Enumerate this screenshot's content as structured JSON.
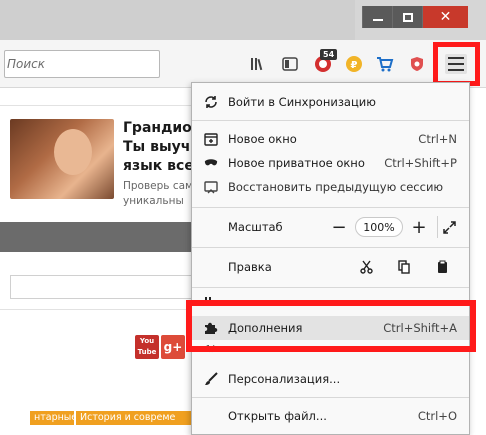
{
  "window": {
    "controls": {
      "minimize": "minimize",
      "maximize": "maximize",
      "close": "✕"
    }
  },
  "toolbar": {
    "search_placeholder": "Поиск",
    "badge_count": "54"
  },
  "page": {
    "headline_lines": [
      "Грандиоз",
      "Ты выучи",
      "язык все"
    ],
    "sub_lines": [
      "Проверь сам",
      "уникальны"
    ],
    "youtube_label_1": "You",
    "youtube_label_2": "Tube",
    "gplus_label": "g+",
    "bottom_tab_1": "нтарные",
    "bottom_tab_2": "История и совреме"
  },
  "menu": {
    "sync": "Войти в Синхронизацию",
    "new_window": "Новое окно",
    "new_window_sc": "Ctrl+N",
    "private_window": "Новое приватное окно",
    "private_window_sc": "Ctrl+Shift+P",
    "restore_session": "Восстановить предыдущую сессию",
    "zoom_label": "Масштаб",
    "zoom_minus": "−",
    "zoom_value": "100%",
    "zoom_plus": "+",
    "edit_label": "Правка",
    "addons": "Дополнения",
    "addons_sc": "Ctrl+Shift+A",
    "customize": "Персонализация...",
    "open_file": "Открыть файл...",
    "open_file_sc": "Ctrl+O"
  },
  "colors": {
    "highlight_border": "#ff1a1a",
    "close_button": "#c8392b",
    "tab_orange": "#f0a020"
  }
}
